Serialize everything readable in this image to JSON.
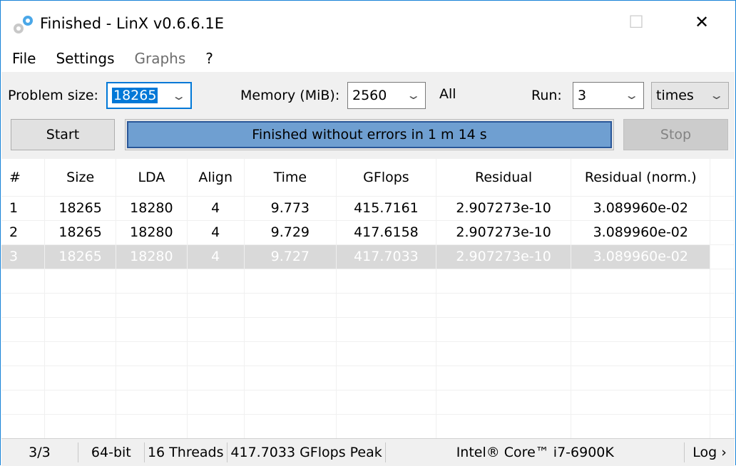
{
  "window": {
    "title": "Finished - LinX v0.6.6.1E",
    "minimize": "—",
    "maximize": "☐",
    "close": "✕"
  },
  "menu": [
    {
      "label": "File"
    },
    {
      "label": "Settings"
    },
    {
      "label": "Graphs"
    },
    {
      "label": "?"
    }
  ],
  "toolbar": {
    "problem_size_label": "Problem size:",
    "problem_size_value": "18265",
    "memory_label": "Memory (MiB):",
    "memory_value": "2560",
    "all_label": "All",
    "run_label": "Run:",
    "run_value": "3",
    "run_unit": "times",
    "start_label": "Start",
    "stop_label": "Stop",
    "status_text": "Finished without errors in 1 m 14 s",
    "progress_percent": 100
  },
  "table": {
    "headers": [
      "#",
      "Size",
      "LDA",
      "Align",
      "Time",
      "GFlops",
      "Residual",
      "Residual (norm.)"
    ],
    "rows": [
      [
        "1",
        "18265",
        "18280",
        "4",
        "9.773",
        "415.7161",
        "2.907273e-10",
        "3.089960e-02"
      ],
      [
        "2",
        "18265",
        "18280",
        "4",
        "9.729",
        "417.6158",
        "2.907273e-10",
        "3.089960e-02"
      ],
      [
        "3",
        "18265",
        "18280",
        "4",
        "9.727",
        "417.7033",
        "2.907273e-10",
        "3.089960e-02"
      ]
    ],
    "selected_row": 2
  },
  "statusbar": {
    "runs": "3/3",
    "bits": "64-bit",
    "threads": "16 Threads",
    "peak": "417.7033 GFlops Peak",
    "cpu": "Intel® Core™ i7-6900K",
    "log": "Log ›"
  }
}
